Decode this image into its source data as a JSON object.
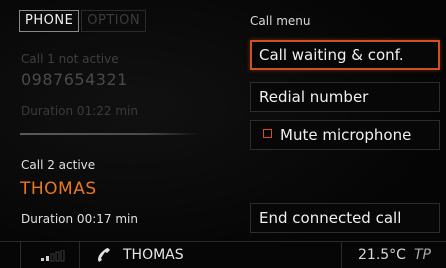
{
  "tabs": [
    {
      "label": "PHONE",
      "active": true
    },
    {
      "label": "OPTION",
      "active": false
    }
  ],
  "call1": {
    "status": "Call 1 not active",
    "number": "0987654321",
    "duration": "Duration 01:22 min"
  },
  "call2": {
    "status": "Call 2 active",
    "name": "THOMAS",
    "duration": "Duration 00:17 min"
  },
  "menu": {
    "title": "Call menu",
    "items": [
      {
        "label": "Call waiting & conf.",
        "selected": true
      },
      {
        "label": "Redial number",
        "selected": false
      },
      {
        "label": "Mute microphone",
        "selected": false,
        "checkbox": true
      },
      {
        "label": "End connected call",
        "selected": false
      }
    ]
  },
  "statusbar": {
    "signal_icon": "signal-strength-icon",
    "phone_icon": "phone-handset-icon",
    "caller": "THOMAS",
    "temperature": "21.5°C",
    "tp_label": "TP"
  },
  "colors": {
    "accent": "#d0521a",
    "active_name": "#e9781f",
    "inactive_text": "#4a4a4a",
    "background": "#050505"
  }
}
